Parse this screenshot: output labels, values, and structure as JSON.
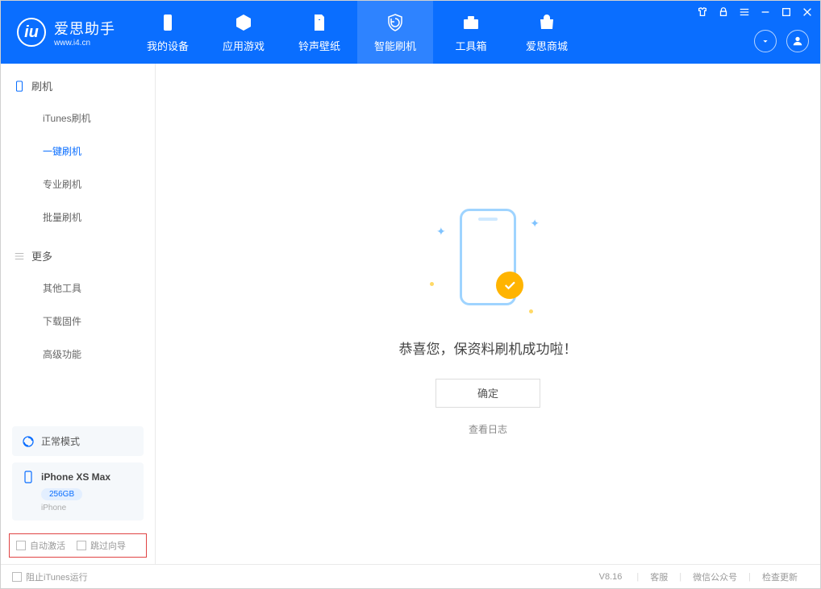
{
  "app": {
    "name": "爱思助手",
    "domain": "www.i4.cn"
  },
  "nav": {
    "tabs": [
      {
        "label": "我的设备"
      },
      {
        "label": "应用游戏"
      },
      {
        "label": "铃声壁纸"
      },
      {
        "label": "智能刷机"
      },
      {
        "label": "工具箱"
      },
      {
        "label": "爱思商城"
      }
    ],
    "active_index": 3
  },
  "sidebar": {
    "section_flash": {
      "title": "刷机",
      "items": [
        "iTunes刷机",
        "一键刷机",
        "专业刷机",
        "批量刷机"
      ],
      "active_index": 1
    },
    "section_more": {
      "title": "更多",
      "items": [
        "其他工具",
        "下载固件",
        "高级功能"
      ]
    },
    "mode": "正常模式",
    "device": {
      "name": "iPhone XS Max",
      "storage": "256GB",
      "type": "iPhone"
    },
    "checkboxes": {
      "auto_activate": "自动激活",
      "skip_guide": "跳过向导"
    }
  },
  "main": {
    "success_text": "恭喜您，保资料刷机成功啦！",
    "ok_button": "确定",
    "log_link": "查看日志"
  },
  "footer": {
    "block_itunes": "阻止iTunes运行",
    "version": "V8.16",
    "links": [
      "客服",
      "微信公众号",
      "检查更新"
    ]
  }
}
